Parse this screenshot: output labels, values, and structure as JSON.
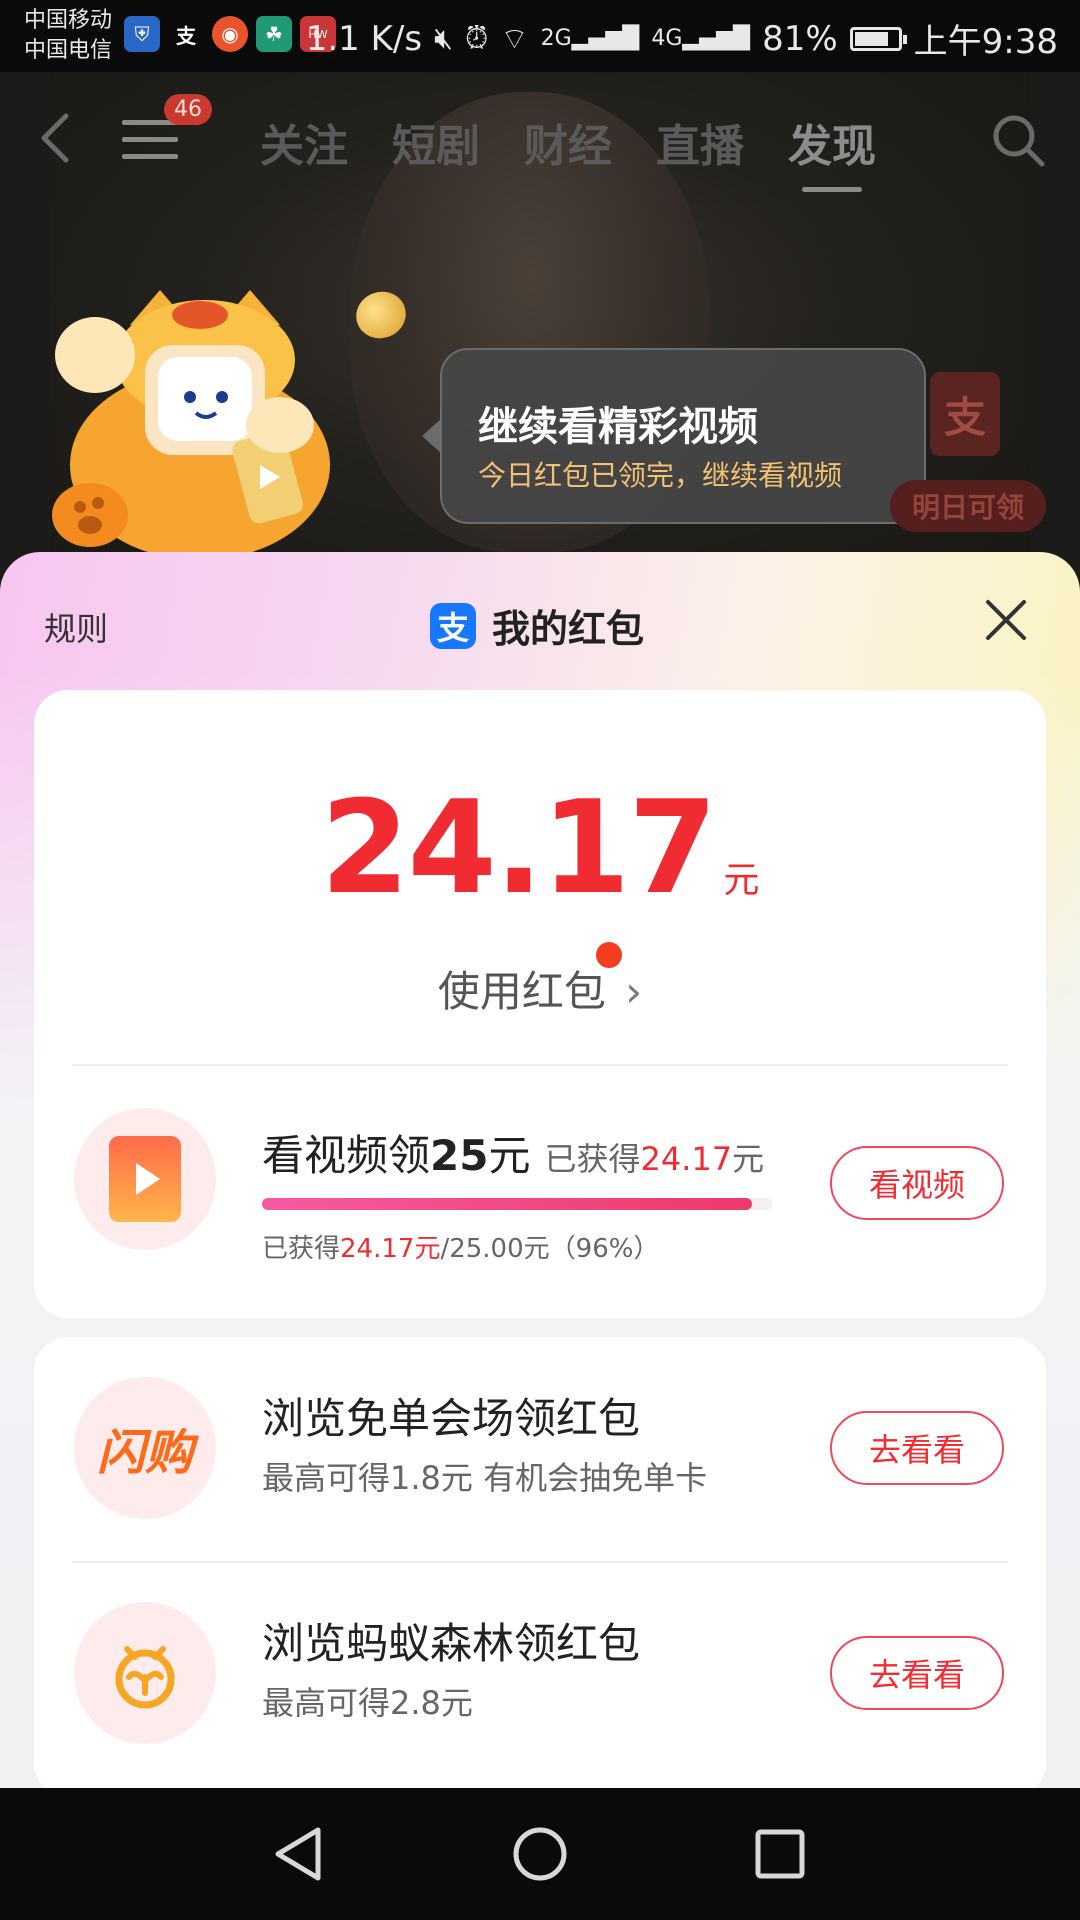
{
  "status_bar": {
    "carrier_1": "中国移动",
    "carrier_2": "中国电信",
    "app_icons": [
      "shield-icon",
      "alipay-icon",
      "video-app-icon",
      "bank-icon",
      "huawei-icon"
    ],
    "network_speed": "1.1 K/s",
    "signal_1": "2G",
    "signal_2": "4G",
    "battery": "81%",
    "battery_level": 0.81,
    "time": "上午9:38"
  },
  "video_nav": {
    "badge": "46",
    "tabs": [
      {
        "label": "关注"
      },
      {
        "label": "短剧"
      },
      {
        "label": "财经"
      },
      {
        "label": "直播"
      },
      {
        "label": "发现",
        "active": true
      }
    ]
  },
  "tooltip": {
    "title": "继续看精彩视频",
    "subtitle": "今日红包已领完，继续看视频"
  },
  "side_rail": {
    "logo": "支",
    "pill_label": "明日可领"
  },
  "sheet": {
    "rules": "规则",
    "logo_char": "支",
    "title": "我的红包"
  },
  "balance": {
    "amount": "24.17",
    "unit": "元",
    "use_link": "使用红包",
    "chevron": "›"
  },
  "video_task": {
    "title_prefix": "看视频领",
    "title_bold": "25",
    "title_suffix": "元",
    "earned_prefix": "已获得",
    "earned_value": "24.17",
    "earned_unit": "元",
    "progress": 0.96,
    "note_prefix": "已获得",
    "note_value": "24.17元",
    "note_suffix": "/25.00元（96%）",
    "button": "看视频"
  },
  "tasks": [
    {
      "icon": "flash-buy-icon",
      "logo_text": "闪购",
      "title": "浏览免单会场领红包",
      "subtitle": "最高可得1.8元 有机会抽免单卡",
      "button": "去看看"
    },
    {
      "icon": "ant-forest-icon",
      "title": "浏览蚂蚁森林领红包",
      "subtitle": "最高可得2.8元",
      "button": "去看看"
    }
  ],
  "colors": {
    "accent_red": "#f12b32",
    "alipay_blue": "#1677ff",
    "progress_pink": "#ee3a6a"
  }
}
